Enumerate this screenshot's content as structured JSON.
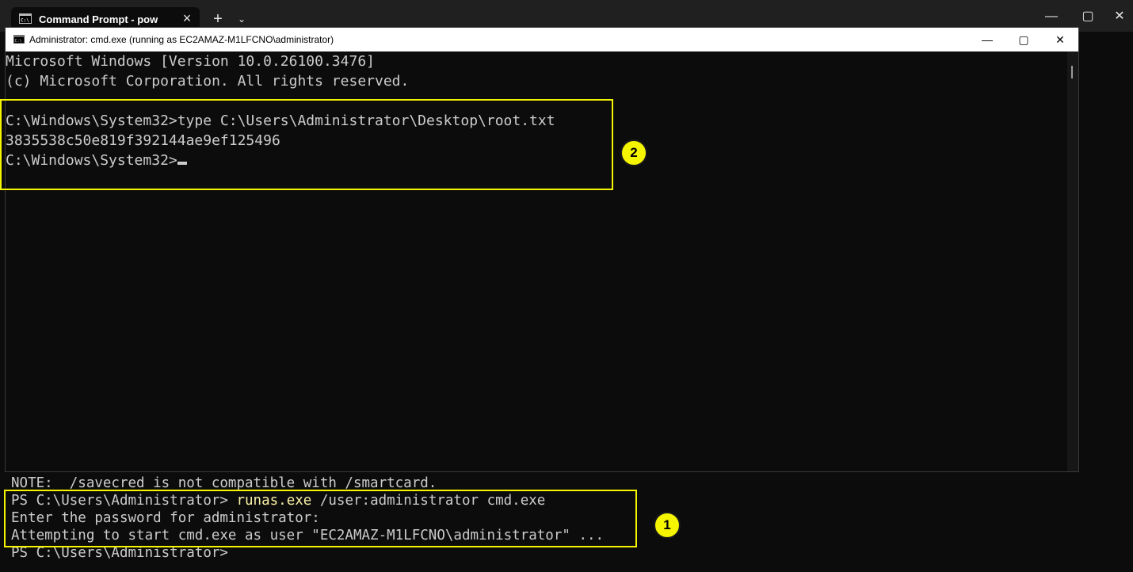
{
  "terminal_window": {
    "tab_title": "Command Prompt - powershe",
    "new_tab_label": "+",
    "dropdown_label": "⌄",
    "minimize_label": "—",
    "maximize_label": "▢",
    "close_label": "✕",
    "tab_close_label": "×"
  },
  "powershell": {
    "lines": [
      {
        "text": "NOTE:  /savecred is not compatible with /smartcard."
      },
      {
        "prompt": "PS C:\\Users\\Administrator> ",
        "cmd": "runas.exe",
        "args": " /user:administrator cmd.exe"
      },
      {
        "text": "Enter the password for administrator:"
      },
      {
        "text": "Attempting to start cmd.exe as user \"EC2AMAZ-M1LFCNO\\administrator\" ..."
      },
      {
        "text": "PS C:\\Users\\Administrator>"
      }
    ]
  },
  "cmd_window": {
    "title": "Administrator: cmd.exe (running as EC2AMAZ-M1LFCNO\\administrator)",
    "minimize_label": "—",
    "maximize_label": "▢",
    "close_label": "✕",
    "lines": [
      "Microsoft Windows [Version 10.0.26100.3476]",
      "(c) Microsoft Corporation. All rights reserved.",
      "",
      "C:\\Windows\\System32>type C:\\Users\\Administrator\\Desktop\\root.txt",
      "3835538c50e819f392144ae9ef125496",
      "C:\\Windows\\System32>"
    ]
  },
  "annotations": {
    "badge_1": "1",
    "badge_2": "2",
    "highlight_color": "#f5f500"
  },
  "colors": {
    "terminal_bg": "#0c0c0c",
    "terminal_text": "#cccccc",
    "command_highlight": "#f9f1a5"
  }
}
